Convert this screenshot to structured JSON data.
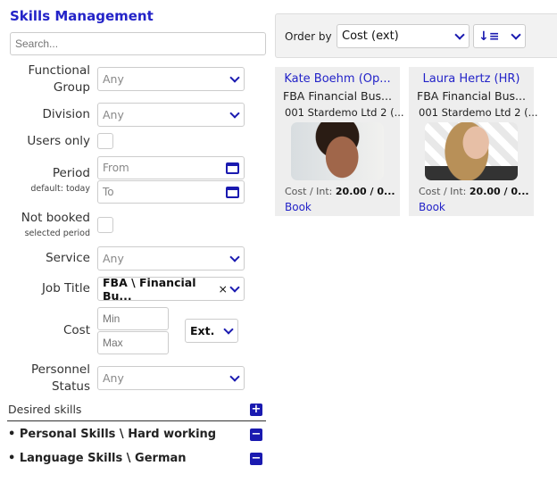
{
  "title": "Skills Management",
  "search": {
    "placeholder": "Search..."
  },
  "filters": {
    "functional_group": {
      "label": "Functional Group",
      "value": "Any"
    },
    "division": {
      "label": "Division",
      "value": "Any"
    },
    "users_only": {
      "label": "Users only",
      "checked": false
    },
    "period": {
      "label": "Period",
      "sub": "default: today",
      "from_placeholder": "From",
      "to_placeholder": "To"
    },
    "not_booked": {
      "label": "Not booked",
      "sub": "selected period",
      "checked": false
    },
    "service": {
      "label": "Service",
      "value": "Any"
    },
    "job_title": {
      "label": "Job Title",
      "value": "FBA \\ Financial Bu...",
      "clear": "×"
    },
    "cost": {
      "label": "Cost",
      "min_placeholder": "Min",
      "max_placeholder": "Max",
      "type": "Ext."
    },
    "personnel_status": {
      "label": "Personnel Status",
      "value": "Any"
    }
  },
  "desired_skills": {
    "label": "Desired skills",
    "items": [
      "Personal Skills \\ Hard working",
      "Language Skills \\ German"
    ]
  },
  "toolbar": {
    "order_by_label": "Order by",
    "order_by_value": "Cost (ext)"
  },
  "cards": [
    {
      "name": "Kate Boehm (Op...",
      "job": "FBA Financial Bus...",
      "company": "001 Stardemo Ltd 2 (...",
      "cost_label": "Cost / Int:",
      "cost_value": "20.00 / 0...",
      "book": "Book"
    },
    {
      "name": "Laura Hertz (HR)",
      "job": "FBA Financial Bus...",
      "company": "001 Stardemo Ltd 2 (...",
      "cost_label": "Cost / Int:",
      "cost_value": "20.00 / 0...",
      "book": "Book"
    }
  ],
  "colors": {
    "accent": "#2323c8",
    "icon": "#1a1ab0"
  }
}
